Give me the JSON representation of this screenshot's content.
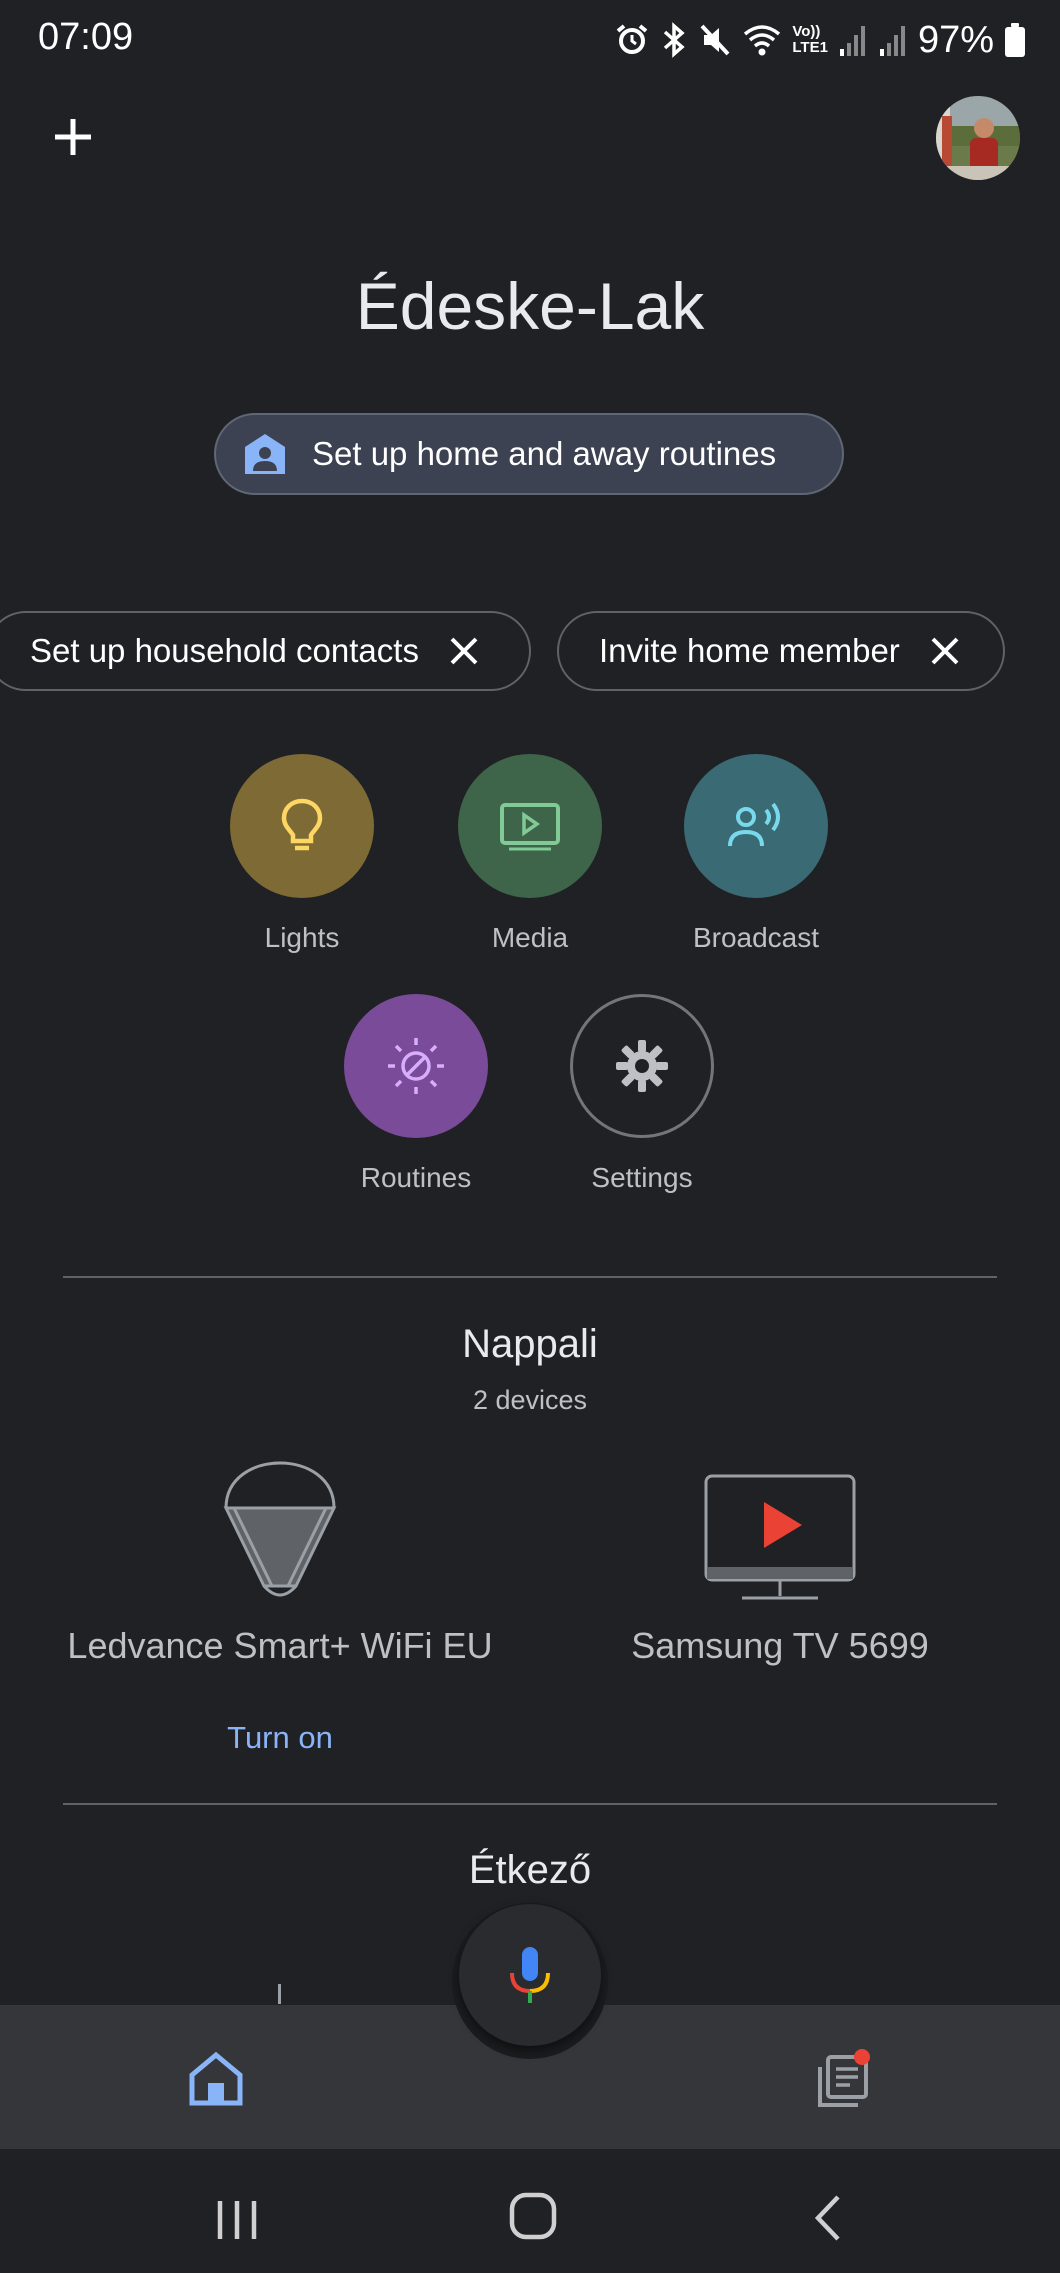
{
  "status_bar": {
    "time": "07:09",
    "battery": "97%",
    "icons": [
      "alarm-icon",
      "bluetooth-icon",
      "mute-icon",
      "wifi-icon",
      "volte-icon",
      "signal-icon",
      "signal-icon",
      "battery-icon"
    ],
    "volte_label_top": "Vo))",
    "volte_label_bottom": "LTE1"
  },
  "header": {
    "add_icon": "plus-icon",
    "avatar": "profile-avatar"
  },
  "home": {
    "title": "Édeske-Lak",
    "routine_chip": "Set up home and away routines"
  },
  "suggestions": [
    {
      "label": "Set up household contacts"
    },
    {
      "label": "Invite home member"
    }
  ],
  "actions": [
    {
      "label": "Lights",
      "icon": "lightbulb-icon",
      "color": "#7e6a35"
    },
    {
      "label": "Media",
      "icon": "play-icon",
      "color": "#3e6449"
    },
    {
      "label": "Broadcast",
      "icon": "broadcast-icon",
      "color": "#3a6a74"
    },
    {
      "label": "Routines",
      "icon": "routines-icon",
      "color": "#7a4b98"
    },
    {
      "label": "Settings",
      "icon": "gear-icon",
      "color": "#202124"
    }
  ],
  "rooms": [
    {
      "name": "Nappali",
      "count": "2 devices",
      "devices": [
        {
          "name": "Ledvance Smart+ WiFi EU",
          "icon": "lamp-icon",
          "action": "Turn on"
        },
        {
          "name": "Samsung TV 5699",
          "icon": "tv-icon"
        }
      ]
    },
    {
      "name": "Étkező"
    }
  ],
  "bottom_nav": {
    "items": [
      "home-icon",
      "feed-icon"
    ]
  },
  "colors": {
    "background": "#202124",
    "accent": "#8ab4f8",
    "notification": "#ea4335"
  }
}
